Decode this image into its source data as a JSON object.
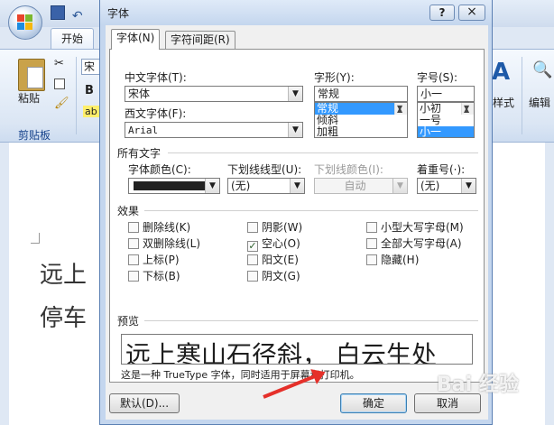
{
  "word": {
    "home_tab": "开始",
    "paste_label": "粘贴",
    "clipboard_group": "剪贴板",
    "font_box": "宋体",
    "bold": "B",
    "styles_label": "样式",
    "edit_label": "编辑",
    "doc_line1": "远上",
    "doc_line2": "停车",
    "watermark": "Bai 经验"
  },
  "dialog": {
    "title": "字体",
    "help": "?",
    "close": "×",
    "tabs": [
      "字体(N)",
      "字符间距(R)"
    ],
    "chinese_font_label": "中文字体(T):",
    "chinese_font_value": "宋体",
    "western_font_label": "西文字体(F):",
    "western_font_value": "Arial",
    "style_label": "字形(Y):",
    "style_value": "常规",
    "style_options": [
      "常规",
      "倾斜",
      "加粗"
    ],
    "size_label": "字号(S):",
    "size_value": "小一",
    "size_options": [
      "小初",
      "一号",
      "小一"
    ],
    "all_text_header": "所有文字",
    "font_color_label": "字体颜色(C):",
    "underline_style_label": "下划线线型(U):",
    "underline_style_value": "(无)",
    "underline_color_label": "下划线颜色(I):",
    "underline_color_value": "自动",
    "emphasis_label": "着重号(·):",
    "emphasis_value": "(无)",
    "effects_header": "效果",
    "effects": {
      "strikethrough": "删除线(K)",
      "double_strikethrough": "双删除线(L)",
      "superscript": "上标(P)",
      "subscript": "下标(B)",
      "shadow": "阴影(W)",
      "outline": "空心(O)",
      "emboss": "阳文(E)",
      "engrave": "阴文(G)",
      "small_caps": "小型大写字母(M)",
      "all_caps": "全部大写字母(A)",
      "hidden": "隐藏(H)"
    },
    "preview_header": "预览",
    "preview_text": "远上寒山石径斜，  白云生处",
    "preview_desc": "这是一种 TrueType 字体，同时适用于屏幕和打印机。",
    "default_button": "默认(D)...",
    "ok_button": "确定",
    "cancel_button": "取消"
  }
}
